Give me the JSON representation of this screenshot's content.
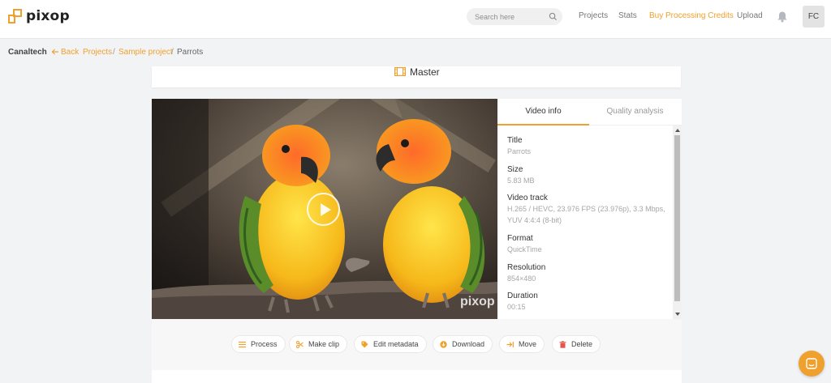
{
  "brand": {
    "name": "pixop",
    "accent_color": "#f0a02c"
  },
  "header": {
    "search_placeholder": "Search here",
    "nav": [
      "Projects",
      "Stats",
      "Buy Processing Credits",
      "Upload"
    ],
    "avatar_initials": "FC"
  },
  "breadcrumb": {
    "org": "Canaltech",
    "back": "Back",
    "items": [
      "Projects",
      "Sample project",
      "Parrots"
    ],
    "separator": "/"
  },
  "master": {
    "title": "Master"
  },
  "video": {
    "watermark": "pixop",
    "watermark_url": "www.pixop"
  },
  "info_panel": {
    "tabs": [
      "Video info",
      "Quality analysis"
    ],
    "items": [
      {
        "label": "Title",
        "value": "Parrots"
      },
      {
        "label": "Size",
        "value": "5.83 MB"
      },
      {
        "label": "Video track",
        "value": "H.265 / HEVC, 23.976 FPS (23.976p), 3.3 Mbps, YUV 4:4:4 (8-bit)"
      },
      {
        "label": "Format",
        "value": "QuickTime"
      },
      {
        "label": "Resolution",
        "value": "854×480"
      },
      {
        "label": "Duration",
        "value": "00:15"
      }
    ]
  },
  "actions": [
    "Process",
    "Make clip",
    "Edit metadata",
    "Download",
    "Move",
    "Delete"
  ]
}
